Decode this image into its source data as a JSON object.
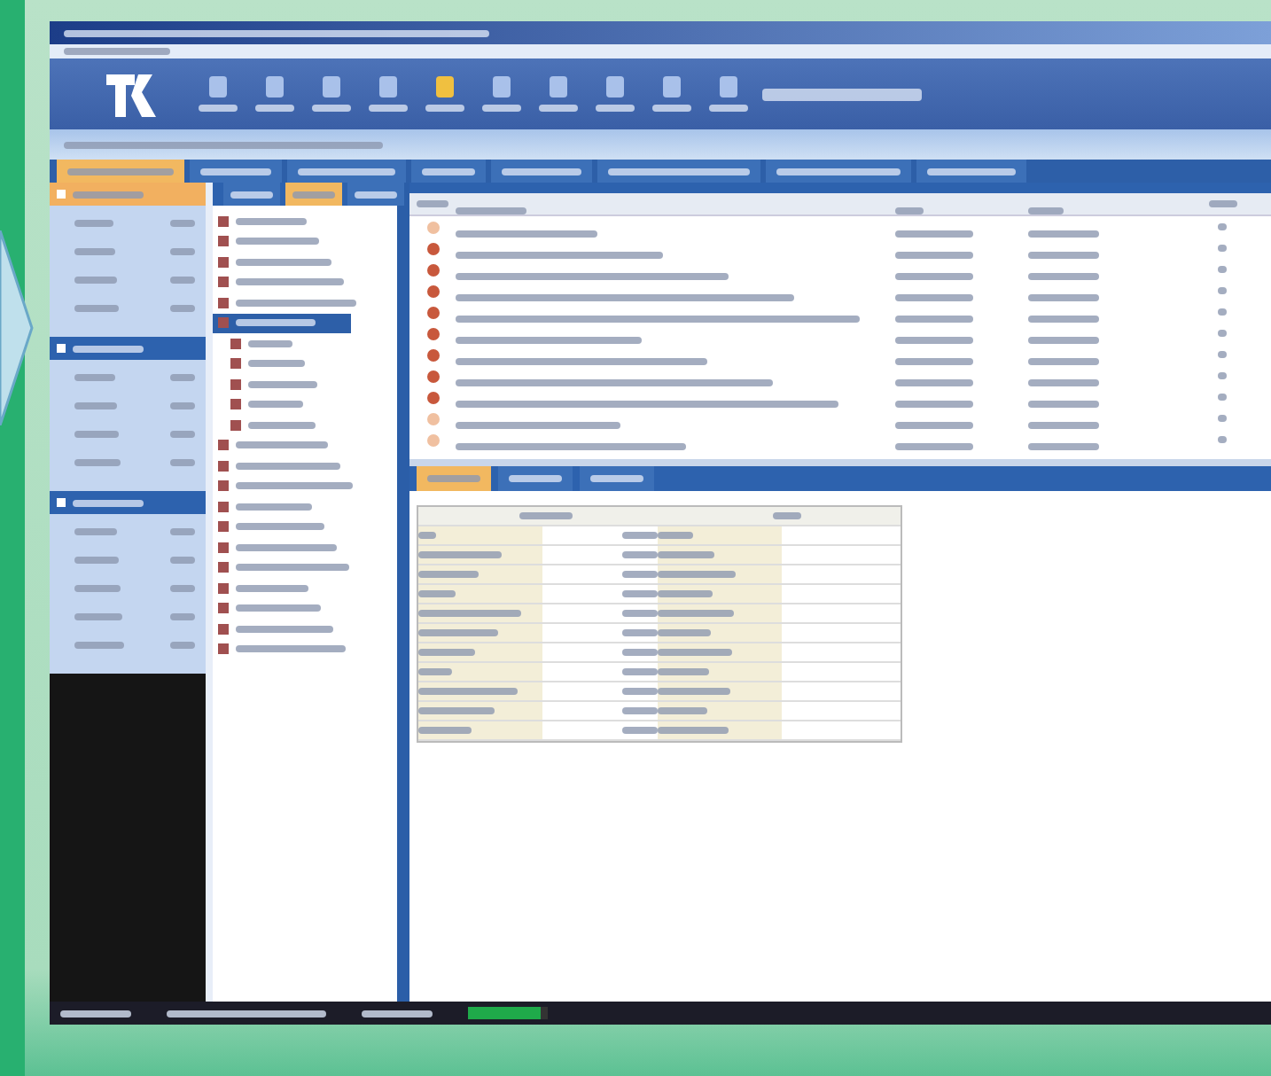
{
  "main_tabs": [
    {
      "selected": true
    },
    {
      "selected": false
    },
    {
      "selected": false
    },
    {
      "selected": false
    },
    {
      "selected": false
    },
    {
      "selected": false
    },
    {
      "selected": false
    },
    {
      "selected": false
    }
  ],
  "side_sections": [
    {
      "selected": true
    },
    {
      "selected": false
    },
    {
      "selected": false
    }
  ],
  "tree_tabs": [
    {
      "selected": false
    },
    {
      "selected": true
    },
    {
      "selected": false
    }
  ],
  "tree": [
    {
      "selected": false
    },
    {
      "selected": false
    },
    {
      "selected": false
    },
    {
      "selected": false
    },
    {
      "selected": false
    },
    {
      "selected": true,
      "children": [
        {
          "selected": false
        },
        {
          "selected": false
        },
        {
          "selected": false
        },
        {
          "selected": false
        },
        {
          "selected": false
        }
      ]
    },
    {
      "selected": false
    },
    {
      "selected": false
    },
    {
      "selected": false
    },
    {
      "selected": false
    },
    {
      "selected": false
    },
    {
      "selected": false
    },
    {
      "selected": false
    },
    {
      "selected": false
    },
    {
      "selected": false
    },
    {
      "selected": false
    },
    {
      "selected": false
    }
  ],
  "detail_tabs": [
    {
      "selected": true
    },
    {
      "selected": false
    },
    {
      "selected": false
    }
  ],
  "status_bar": {
    "meter": {
      "level": 0.9
    }
  }
}
